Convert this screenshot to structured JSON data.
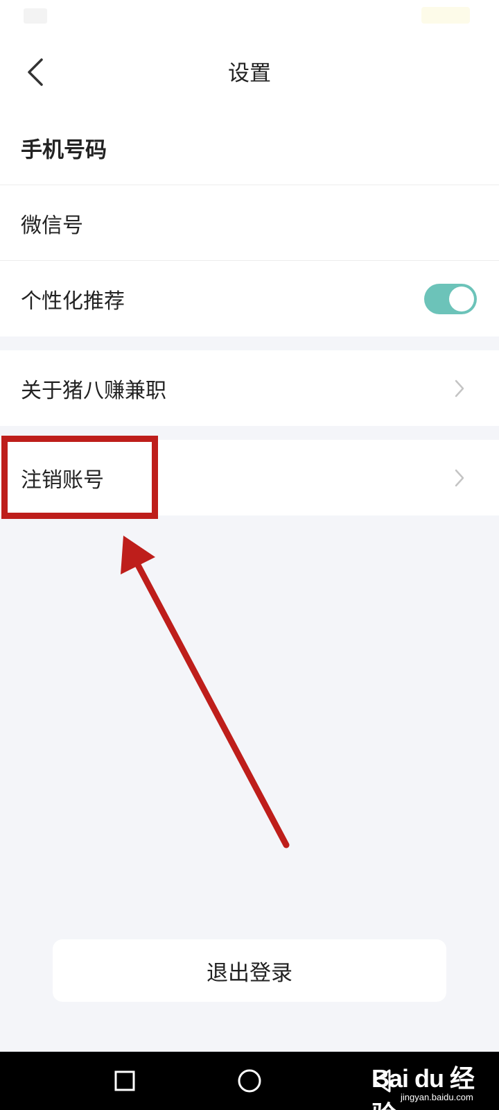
{
  "header": {
    "title": "设置",
    "back_icon": "chevron-left-icon"
  },
  "rows": [
    {
      "label": "手机号码"
    },
    {
      "label": "微信号"
    },
    {
      "label": "个性化推荐",
      "toggle_on": true
    },
    {
      "label": "关于猪八赚兼职"
    },
    {
      "label": "注销账号"
    }
  ],
  "logout_label": "退出登录",
  "colors": {
    "toggle_on": "#6cc3b9",
    "annotation": "#be1e1b",
    "page_bg": "#f4f5f9"
  },
  "watermark": {
    "brand": "Bai du 经验",
    "sub": "jingyan.baidu.com"
  },
  "nav": {
    "recent_icon": "square-icon",
    "home_icon": "circle-icon",
    "back_icon": "triangle-back-icon"
  }
}
